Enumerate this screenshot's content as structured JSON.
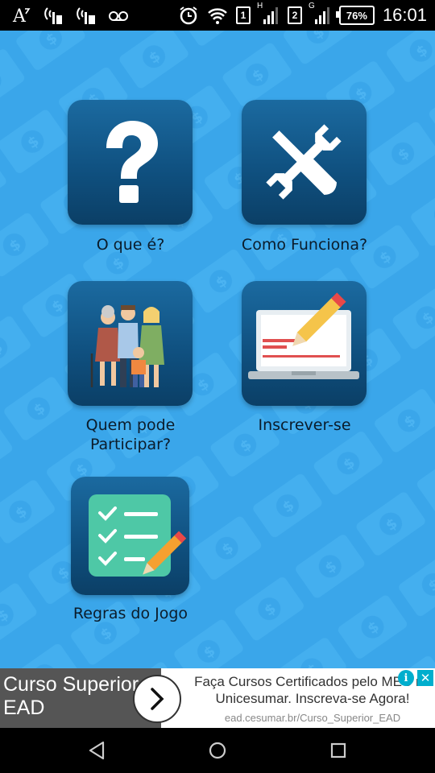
{
  "status_bar": {
    "left_icons": [
      "accessibility-font-icon",
      "signal-sim1-icon",
      "signal-sim2-icon",
      "voicemail-icon"
    ],
    "right_icons": [
      "alarm-icon",
      "wifi-icon",
      "sim1-badge-icon",
      "signal-h-icon",
      "sim2-badge-icon",
      "signal-g-icon"
    ],
    "sim1_label": "1",
    "sim1_network": "H",
    "sim2_label": "2",
    "sim2_network": "G",
    "battery": "76%",
    "time": "16:01"
  },
  "menu": {
    "items": [
      {
        "label": "O que é?",
        "icon": "question-mark-icon"
      },
      {
        "label": "Como Funciona?",
        "icon": "wrench-screwdriver-icon"
      },
      {
        "label": "Quem pode Participar?",
        "icon": "family-icon"
      },
      {
        "label": "Inscrever-se",
        "icon": "laptop-pencil-icon"
      },
      {
        "label": "Regras do Jogo",
        "icon": "checklist-icon"
      }
    ]
  },
  "ad": {
    "left_text": "Curso Superior EAD",
    "headline": "Faça Cursos Certificados pelo MEC na Unicesumar. Inscreva-se Agora!",
    "url": "ead.cesumar.br/Curso_Superior_EAD",
    "info_symbol": "i",
    "close_symbol": "✕"
  },
  "colors": {
    "background": "#3aa6ea",
    "tile": "#0f4f7e",
    "label": "#0b1c2b"
  }
}
